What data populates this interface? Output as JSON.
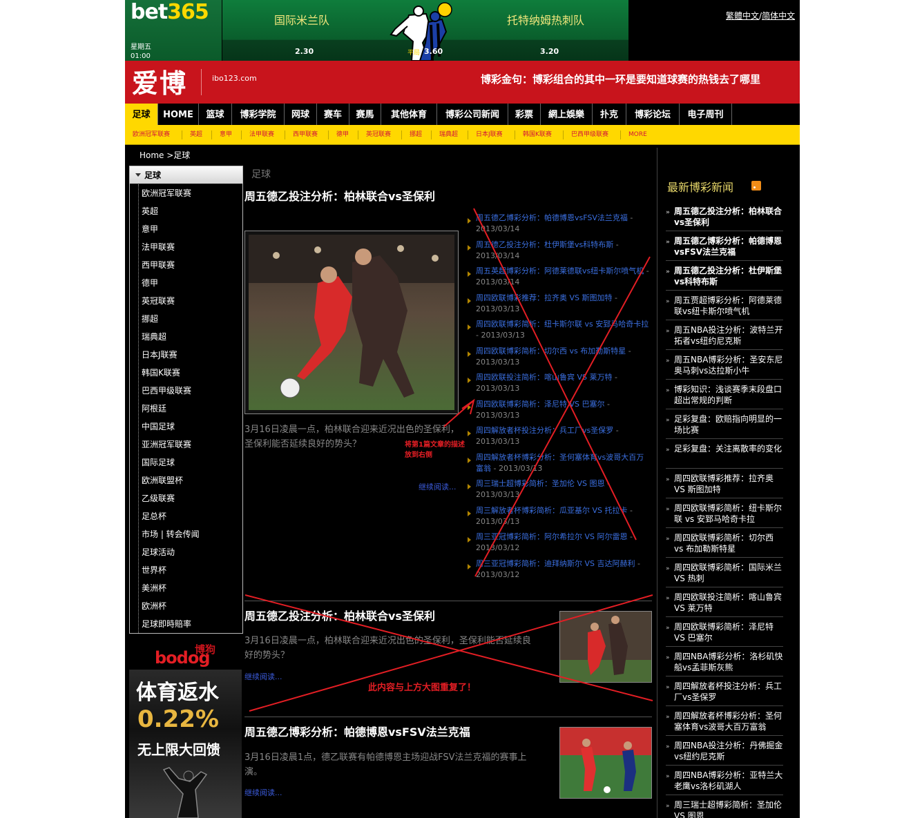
{
  "banner": {
    "brand_bet": "bet",
    "brand_365": "365",
    "day": "星期五",
    "time": "01:00",
    "home_team": "国际米兰队",
    "away_team": "托特纳姆热刺队",
    "odds_home": "2.30",
    "odds_draw_label": "平局",
    "odds_draw": "3.60",
    "odds_away": "3.20",
    "lang_trad": "繁體中文",
    "lang_sep": "/",
    "lang_simp": "简体中文"
  },
  "header": {
    "logo": "爱博",
    "domain": "ibo123.com",
    "slogan": "博彩金句：博彩组合的其中一环是要知道球赛的热钱去了哪里"
  },
  "nav": [
    "足球",
    "HOME",
    "篮球",
    "博彩学院",
    "网球",
    "赛车",
    "赛馬",
    "其他体育",
    "博彩公司新闻",
    "彩票",
    "網上娛樂",
    "扑克",
    "博彩论坛",
    "电子周刊"
  ],
  "subnav": [
    "欧洲冠军联赛",
    "英超",
    "意甲",
    "法甲联赛",
    "西甲联赛",
    "德甲",
    "英冠联赛",
    "挪超",
    "瑞典超",
    "日本J联赛",
    "韩国K联赛",
    "巴西甲级联赛",
    "MORE"
  ],
  "breadcrumb": "Home >足球",
  "sidebar": {
    "heading": "足球",
    "items": [
      "欧洲冠军联赛",
      "英超",
      "意甲",
      "法甲联赛",
      "西甲联赛",
      "德甲",
      "英冠联赛",
      "挪超",
      "瑞典超",
      "日本J联赛",
      "韩国K联赛",
      "巴西甲级联赛",
      "阿根廷",
      "中国足球",
      "亚洲冠军联赛",
      "国际足球",
      "欧洲联盟杯",
      "乙级联赛",
      "足总杯",
      "市场 | 转会传闻",
      "足球活动",
      "世界杯",
      "美洲杯",
      "欧洲杯",
      "足球即時賠率"
    ]
  },
  "ad": {
    "brand_cn": "博狗",
    "brand": "bodog",
    "line1": "体育返水",
    "line2": "0.22%",
    "line3": "无上限大回馈"
  },
  "main": {
    "category": "足球",
    "featured": {
      "title": "周五德乙投注分析：柏林联合vs圣保利",
      "desc": "3月16日凌晨一点，柏林联合迎来近况出色的圣保利，圣保利能否延续良好的势头？",
      "read_more": "继续阅读..."
    },
    "annotation_move": "将第1篇文章的描述放到右侧",
    "news_list": [
      {
        "title": "周五德乙博彩分析：帕德博恩vsFSV法兰克福",
        "date": "2013/03/14"
      },
      {
        "title": "周五德乙投注分析：杜伊斯堡vs科特布斯",
        "date": "2013/03/14"
      },
      {
        "title": "周五英超博彩分析：阿德莱德联vs纽卡斯尔喷气机",
        "date": "2013/03/14"
      },
      {
        "title": "周四欧联博彩推荐：拉齐奥 VS 斯图加特",
        "date": "2013/03/13"
      },
      {
        "title": "周四欧联博彩简析：纽卡斯尔联 vs 安郅马哈奇卡拉",
        "date": "2013/03/13"
      },
      {
        "title": "周四欧联博彩简析：切尔西 vs 布加勒斯特星",
        "date": "2013/03/13"
      },
      {
        "title": "周四欧联投注简析：喀山鲁宾 VS 莱万特",
        "date": "2013/03/13"
      },
      {
        "title": "周四欧联博彩简析：泽尼特 VS 巴塞尔",
        "date": "2013/03/13"
      },
      {
        "title": "周四解放者杯投注分析：兵工厂vs圣保罗",
        "date": "2013/03/13"
      },
      {
        "title": "周四解放者杯博彩分析：圣何塞体育vs波哥大百万富翁",
        "date": "2013/03/13"
      },
      {
        "title": "周三瑞士超博彩简析：圣加伦 VS 图恩",
        "date": "2013/03/13"
      },
      {
        "title": "周三解放者杯博彩简析：瓜亚基尔 VS 托拉卡",
        "date": "2013/03/13"
      },
      {
        "title": "周三亚冠博彩简析：阿尔希拉尔 VS 阿尔雷恩",
        "date": "2013/03/12"
      },
      {
        "title": "周三亚冠博彩简析：迪拜纳斯尔 VS 吉达阿赫利",
        "date": "2013/03/12"
      }
    ],
    "articles": [
      {
        "title": "周五德乙投注分析：柏林联合vs圣保利",
        "desc": "3月16日凌晨一点，柏林联合迎来近况出色的圣保利，圣保利能否延续良好的势头？",
        "read_more": "继续阅读..."
      },
      {
        "title": "周五德乙博彩分析：帕德博恩vsFSV法兰克福",
        "desc": "3月16日凌晨1点，德乙联赛有帕德博恩主场迎战FSV法兰克福的赛事上演。",
        "read_more": "继续阅读..."
      }
    ],
    "annotation_dup": "此内容与上方大图重复了！"
  },
  "right": {
    "title": "最新博彩新闻",
    "items": [
      {
        "text": "周五德乙投注分析：柏林联合vs圣保利",
        "bold": true
      },
      {
        "text": "周五德乙博彩分析：帕德博恩vsFSV法兰克福",
        "bold": true
      },
      {
        "text": "周五德乙投注分析：杜伊斯堡vs科特布斯",
        "bold": true
      },
      {
        "text": "周五贾超博彩分析：阿德莱德联vs纽卡斯尔喷气机",
        "bold": false
      },
      {
        "text": "周五NBA投注分析：波特兰开拓者vs纽约尼克斯",
        "bold": false
      },
      {
        "text": "周五NBA博彩分析：圣安东尼奥马刺vs达拉斯小牛",
        "bold": false
      },
      {
        "text": "博彩知识：浅谈赛季末段盘口超出常规的判断",
        "bold": false
      },
      {
        "text": "足彩复盘：欧赔指向明显的一场比赛",
        "bold": false
      },
      {
        "text": "足彩复盘：关注离散率的变化",
        "bold": false
      },
      {
        "text": "周四欧联博彩推荐：拉齐奥 VS 斯图加特",
        "bold": false
      },
      {
        "text": "周四欧联博彩简析：纽卡斯尔联 vs 安郅马哈奇卡拉",
        "bold": false
      },
      {
        "text": "周四欧联博彩简析：切尔西 vs 布加勒斯特星",
        "bold": false
      },
      {
        "text": "周四欧联博彩简析：国际米兰 VS 热刺",
        "bold": false
      },
      {
        "text": "周四欧联投注简析：喀山鲁宾 VS 莱万特",
        "bold": false
      },
      {
        "text": "周四欧联博彩简析：泽尼特 VS 巴塞尔",
        "bold": false
      },
      {
        "text": "周四NBA博彩分析：洛杉矶快船vs孟菲斯灰熊",
        "bold": false
      },
      {
        "text": "周四解放者杯投注分析：兵工厂vs圣保罗",
        "bold": false
      },
      {
        "text": "周四解放者杯博彩分析：圣何塞体育vs波哥大百万富翁",
        "bold": false
      },
      {
        "text": "周四NBA投注分析：丹佛掘金vs纽约尼克斯",
        "bold": false
      },
      {
        "text": "周四NBA博彩分析：亚特兰大老鹰vs洛杉矶湖人",
        "bold": false
      },
      {
        "text": "周三瑞士超博彩简析：圣加伦 VS 图恩",
        "bold": false
      }
    ]
  },
  "colors": {
    "accent_red": "#c8141c",
    "nav_yellow": "#ffd800",
    "link_blue": "#3b6fe0",
    "annotation_red": "#e31e24"
  }
}
